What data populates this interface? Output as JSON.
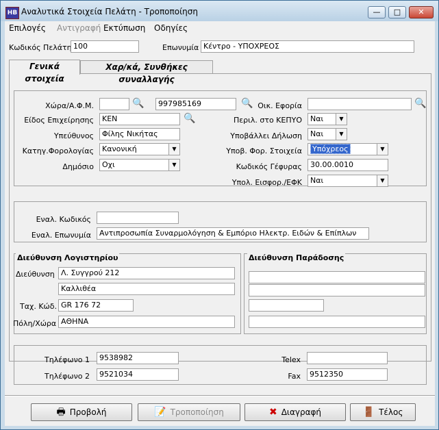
{
  "window": {
    "title": "Αναλυτικά Στοιχεία Πελάτη - Τροποποίηση",
    "icon_text": "HB",
    "min_glyph": "—",
    "max_glyph": "□",
    "close_glyph": "✕"
  },
  "menu": [
    {
      "label": "Επιλογές"
    },
    {
      "label": "Αντιγραφή"
    },
    {
      "label": "Εκτύπωση"
    },
    {
      "label": "Οδηγίες"
    }
  ],
  "header": {
    "code_label": "Κωδικός Πελάτη",
    "code_value": "100",
    "name_label": "Επωνυμία",
    "name_value": "Κέντρο - ΥΠΟΧΡΕΟΣ"
  },
  "tabs": [
    {
      "label": "Γενικά στοιχεία"
    },
    {
      "label": "Χαρ/κά, Συνθήκες συναλλαγής"
    }
  ],
  "general": {
    "country_afm_label": "Χώρα/Α.Φ.Μ.",
    "country_value": "",
    "afm_value": "997985169",
    "tax_office_label": "Οικ. Εφορία",
    "tax_office_value": "",
    "business_type_label": "Είδος Επιχείρησης",
    "business_type_value": "ΚΕΝ",
    "kepyo_label": "Περιλ. στο ΚΕΠΥΟ",
    "kepyo_value": "Ναι",
    "responsible_label": "Υπεύθυνος",
    "responsible_value": "Φίλης Νικήτας",
    "declaration_label": "Υποβάλλει Δήλωση",
    "declaration_value": "Ναι",
    "tax_category_label": "Κατηγ.Φορολογίας",
    "tax_category_value": "Κανονική",
    "tax_data_label": "Υποβ. Φορ. Στοιχεία",
    "tax_data_value": "Υπόχρεος",
    "public_label": "Δημόσιο",
    "public_value": "Οχι",
    "bridge_code_label": "Κωδικός Γέφυρας",
    "bridge_code_value": "30.00.0010",
    "efk_label": "Υπολ. Εισφορ./ΕΦΚ",
    "efk_value": "Ναι"
  },
  "alternate": {
    "alt_code_label": "Εναλ. Κωδικός",
    "alt_code_value": "",
    "alt_name_label": "Εναλ. Επωνυμία",
    "alt_name_value": "Αντιπροσωπία Συναρμολόγηση & Εμπόριο Ηλεκτρ. Ειδών & Επίπλων"
  },
  "accounting_address": {
    "title": "Διεύθυνση Λογιστηρίου",
    "address_label": "Διεύθυνση",
    "address_line1": "Λ. Συγγρού 212",
    "address_line2": "Καλλιθέα",
    "postal_label": "Ταχ. Κώδ.",
    "postal_value": "GR 176 72",
    "city_label": "Πόλη/Χώρα",
    "city_value": "ΑΘΗΝΑ"
  },
  "delivery_address": {
    "title": "Διεύθυνση Παράδοσης",
    "address_line1": "",
    "address_line2": "",
    "postal_value": "",
    "city_value": ""
  },
  "contact": {
    "phone1_label": "Τηλέφωνο 1",
    "phone1_value": "9538982",
    "phone2_label": "Τηλέφωνο 2",
    "phone2_value": "9521034",
    "telex_label": "Telex",
    "telex_value": "",
    "fax_label": "Fax",
    "fax_value": "9512350"
  },
  "buttons": {
    "view": "Προβολή",
    "modify": "Τροποποίηση",
    "delete": "Διαγραφή",
    "end": "Τέλος"
  },
  "icons": {
    "search": "🔍",
    "combo_arrow": "▼",
    "printer": "🖶",
    "modify": "📝",
    "delete": "✖",
    "exit": "🚪"
  },
  "colors": {
    "selection": "#3366cc",
    "delete_icon": "#cc0000"
  }
}
